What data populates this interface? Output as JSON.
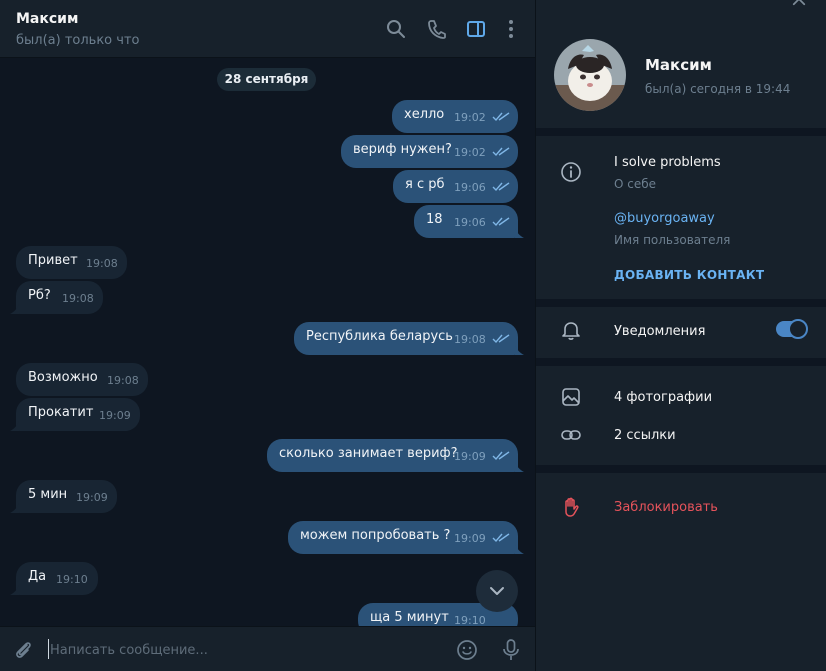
{
  "header": {
    "peer_name": "Максим",
    "peer_status": "был(а) только что",
    "icons": [
      "search-icon",
      "phone-icon",
      "sidebar-toggle-icon",
      "more-vert-icon"
    ]
  },
  "chat": {
    "date_label": "28 сентября",
    "messages": [
      {
        "dir": "out",
        "text": "хелло",
        "time": "19:02"
      },
      {
        "dir": "out",
        "text": "вериф нужен?",
        "time": "19:02"
      },
      {
        "dir": "out",
        "text": "я с рб",
        "time": "19:06"
      },
      {
        "dir": "out",
        "text": "18",
        "time": "19:06"
      },
      {
        "dir": "in",
        "text": "Привет",
        "time": "19:08"
      },
      {
        "dir": "in",
        "text": "Рб?",
        "time": "19:08"
      },
      {
        "dir": "out",
        "text": "Республика беларусь",
        "time": "19:08"
      },
      {
        "dir": "in",
        "text": "Возможно",
        "time": "19:08"
      },
      {
        "dir": "in",
        "text": "Прокатит",
        "time": "19:09"
      },
      {
        "dir": "out",
        "text": "сколько занимает вериф?",
        "time": "19:09"
      },
      {
        "dir": "in",
        "text": "5 мин",
        "time": "19:09"
      },
      {
        "dir": "out",
        "text": "можем попробовать ?",
        "time": "19:09"
      },
      {
        "dir": "in",
        "text": "Да",
        "time": "19:10"
      },
      {
        "dir": "out",
        "text": "ща 5 минут",
        "time": "19:10"
      }
    ]
  },
  "composer": {
    "placeholder": "Написать сообщение...",
    "value": ""
  },
  "profile": {
    "name": "Максим",
    "status": "был(а) сегодня в 19:44",
    "bio": "I solve problems",
    "bio_label": "О себе",
    "username": "@buyorgoaway",
    "username_label": "Имя пользователя",
    "add_contact_label": "ДОБАВИТЬ КОНТАКТ",
    "notifications_label": "Уведомления",
    "notifications_enabled": true,
    "photos_label": "4 фотографии",
    "links_label": "2 ссылки",
    "block_label": "Заблокировать"
  },
  "colors": {
    "chat_bg": "#0e1621",
    "panel_bg": "#17212b",
    "outgoing_bubble": "#2b5278",
    "incoming_bubble": "#182533",
    "accent": "#6ab3f3",
    "danger": "#e5535b"
  }
}
